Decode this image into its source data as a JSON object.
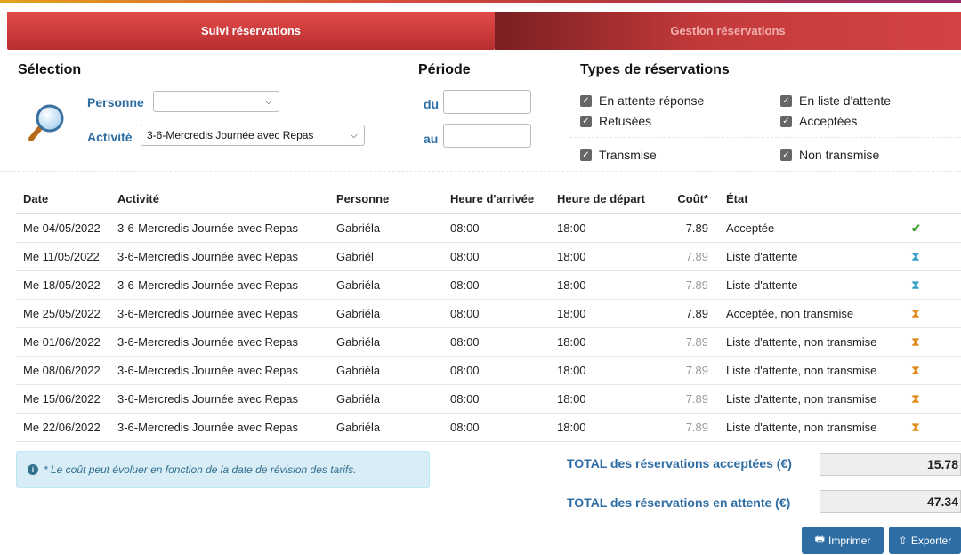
{
  "tabs": {
    "active": "Suivi réservations",
    "inactive": "Gestion réservations"
  },
  "selection": {
    "title": "Sélection",
    "person_label": "Personne",
    "person_value": "",
    "activity_label": "Activité",
    "activity_value": "3-6-Mercredis Journée avec Repas"
  },
  "period": {
    "title": "Période",
    "from_label": "du",
    "to_label": "au",
    "from_value": "",
    "to_value": ""
  },
  "types": {
    "title": "Types de réservations",
    "items": [
      {
        "label": "En attente réponse",
        "checked": true
      },
      {
        "label": "En liste d'attente",
        "checked": true
      },
      {
        "label": "Refusées",
        "checked": true
      },
      {
        "label": "Acceptées",
        "checked": true
      },
      {
        "label": "Transmise",
        "checked": true
      },
      {
        "label": "Non transmise",
        "checked": true
      }
    ]
  },
  "table": {
    "headers": [
      "Date",
      "Activité",
      "Personne",
      "Heure d'arrivée",
      "Heure de départ",
      "Coût*",
      "État"
    ],
    "rows": [
      {
        "date": "Me 04/05/2022",
        "activity": "3-6-Mercredis Journée avec Repas",
        "person": "Gabriéla",
        "arrival": "08:00",
        "departure": "18:00",
        "cost": "7.89",
        "state": "Acceptée",
        "icon": "check-icon"
      },
      {
        "date": "Me 11/05/2022",
        "activity": "3-6-Mercredis Journée avec Repas",
        "person": "Gabriél",
        "arrival": "08:00",
        "departure": "18:00",
        "cost": "7.89",
        "state": "Liste d'attente",
        "icon": "hourglass-blue-icon"
      },
      {
        "date": "Me 18/05/2022",
        "activity": "3-6-Mercredis Journée avec Repas",
        "person": "Gabriéla",
        "arrival": "08:00",
        "departure": "18:00",
        "cost": "7.89",
        "state": "Liste d'attente",
        "icon": "hourglass-blue-icon"
      },
      {
        "date": "Me 25/05/2022",
        "activity": "3-6-Mercredis Journée avec Repas",
        "person": "Gabriéla",
        "arrival": "08:00",
        "departure": "18:00",
        "cost": "7.89",
        "state": "Acceptée, non transmise",
        "icon": "hourglass-orange-icon"
      },
      {
        "date": "Me 01/06/2022",
        "activity": "3-6-Mercredis Journée avec Repas",
        "person": "Gabriéla",
        "arrival": "08:00",
        "departure": "18:00",
        "cost": "7.89",
        "state": "Liste d'attente, non transmise",
        "icon": "hourglass-orange-icon"
      },
      {
        "date": "Me 08/06/2022",
        "activity": "3-6-Mercredis Journée avec Repas",
        "person": "Gabriéla",
        "arrival": "08:00",
        "departure": "18:00",
        "cost": "7.89",
        "state": "Liste d'attente, non transmise",
        "icon": "hourglass-orange-icon"
      },
      {
        "date": "Me 15/06/2022",
        "activity": "3-6-Mercredis Journée avec Repas",
        "person": "Gabriéla",
        "arrival": "08:00",
        "departure": "18:00",
        "cost": "7.89",
        "state": "Liste d'attente, non transmise",
        "icon": "hourglass-orange-icon"
      },
      {
        "date": "Me 22/06/2022",
        "activity": "3-6-Mercredis Journée avec Repas",
        "person": "Gabriéla",
        "arrival": "08:00",
        "departure": "18:00",
        "cost": "7.89",
        "state": "Liste d'attente, non transmise",
        "icon": "hourglass-orange-icon"
      }
    ]
  },
  "note": "* Le coût peut évoluer en fonction de la date de révision des tarifs.",
  "totals": {
    "accepted_label": "TOTAL des réservations acceptées (€)",
    "accepted_value": "15.78",
    "pending_label": "TOTAL des réservations en attente (€)",
    "pending_value": "47.34"
  },
  "buttons": {
    "print": "Imprimer",
    "export": "Exporter"
  },
  "colors": {
    "primary": "#2e6da4",
    "tab_red": "#d84343",
    "success": "#3c9a2a",
    "waiting_blue": "#3aa0c9",
    "waiting_orange": "#e38a1b"
  }
}
